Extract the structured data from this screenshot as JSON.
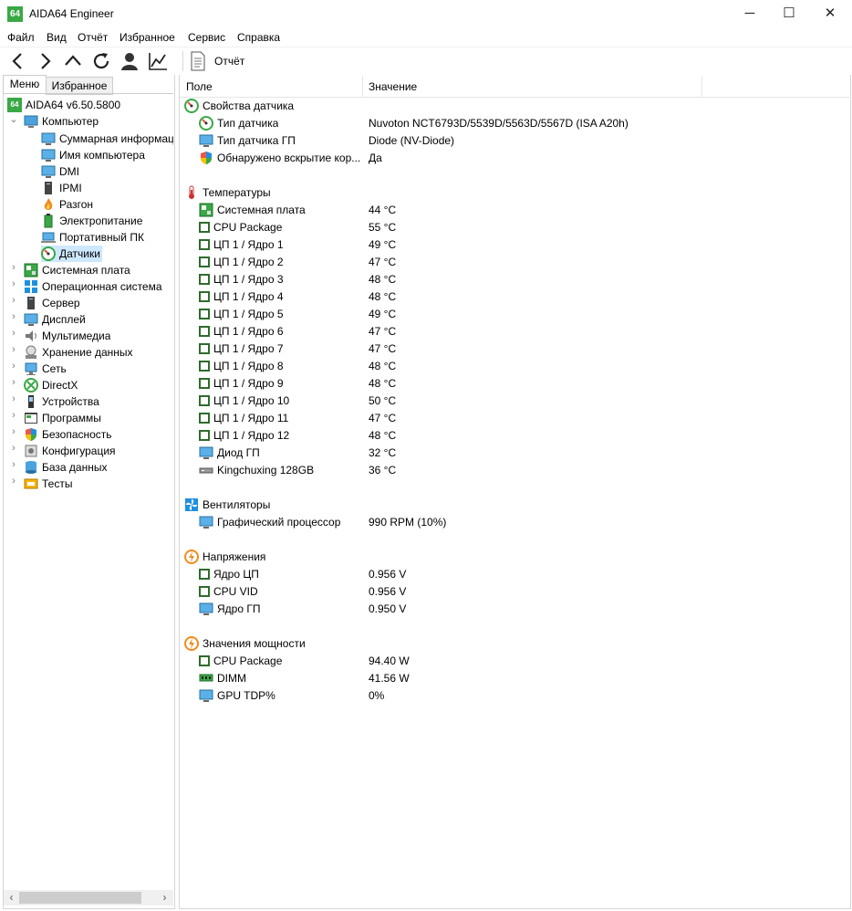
{
  "app": {
    "title": "AIDA64 Engineer",
    "logo": "64"
  },
  "window_controls": {
    "minimize": "─",
    "maximize": "☐",
    "close": "✕"
  },
  "menu": [
    "Файл",
    "Вид",
    "Отчёт",
    "Избранное",
    "Сервис",
    "Справка"
  ],
  "toolbar": {
    "report": "Отчёт"
  },
  "tabs": {
    "menu": "Меню",
    "favorites": "Избранное"
  },
  "tree": {
    "root": "AIDA64 v6.50.5800",
    "computer": "Компьютер",
    "computer_children": [
      "Суммарная информация",
      "Имя компьютера",
      "DMI",
      "IPMI",
      "Разгон",
      "Электропитание",
      "Портативный ПК",
      "Датчики"
    ],
    "top_items": [
      "Системная плата",
      "Операционная система",
      "Сервер",
      "Дисплей",
      "Мультимедиа",
      "Хранение данных",
      "Сеть",
      "DirectX",
      "Устройства",
      "Программы",
      "Безопасность",
      "Конфигурация",
      "База данных",
      "Тесты"
    ]
  },
  "columns": {
    "field": "Поле",
    "value": "Значение"
  },
  "sections": [
    {
      "title": "Свойства датчика",
      "rows": [
        {
          "field": "Тип датчика",
          "value": "Nuvoton NCT6793D/5539D/5563D/5567D  (ISA A20h)",
          "icon": "sensor"
        },
        {
          "field": "Тип датчика ГП",
          "value": "Diode  (NV-Diode)",
          "icon": "monitor"
        },
        {
          "field": "Обнаружено вскрытие кор...",
          "value": "Да",
          "icon": "shield"
        }
      ]
    },
    {
      "title": "Температуры",
      "rows": [
        {
          "field": "Системная плата",
          "value": "44 °C",
          "icon": "board"
        },
        {
          "field": "CPU Package",
          "value": "55 °C",
          "icon": "chip"
        },
        {
          "field": "ЦП 1 / Ядро 1",
          "value": "49 °C",
          "icon": "chip"
        },
        {
          "field": "ЦП 1 / Ядро 2",
          "value": "47 °C",
          "icon": "chip"
        },
        {
          "field": "ЦП 1 / Ядро 3",
          "value": "48 °C",
          "icon": "chip"
        },
        {
          "field": "ЦП 1 / Ядро 4",
          "value": "48 °C",
          "icon": "chip"
        },
        {
          "field": "ЦП 1 / Ядро 5",
          "value": "49 °C",
          "icon": "chip"
        },
        {
          "field": "ЦП 1 / Ядро 6",
          "value": "47 °C",
          "icon": "chip"
        },
        {
          "field": "ЦП 1 / Ядро 7",
          "value": "47 °C",
          "icon": "chip"
        },
        {
          "field": "ЦП 1 / Ядро 8",
          "value": "48 °C",
          "icon": "chip"
        },
        {
          "field": "ЦП 1 / Ядро 9",
          "value": "48 °C",
          "icon": "chip"
        },
        {
          "field": "ЦП 1 / Ядро 10",
          "value": "50 °C",
          "icon": "chip"
        },
        {
          "field": "ЦП 1 / Ядро 11",
          "value": "47 °C",
          "icon": "chip"
        },
        {
          "field": "ЦП 1 / Ядро 12",
          "value": "48 °C",
          "icon": "chip"
        },
        {
          "field": "Диод ГП",
          "value": "32 °C",
          "icon": "monitor"
        },
        {
          "field": "Kingchuxing 128GB",
          "value": "36 °C",
          "icon": "disk"
        }
      ]
    },
    {
      "title": "Вентиляторы",
      "rows": [
        {
          "field": "Графический процессор",
          "value": "990 RPM  (10%)",
          "icon": "monitor"
        }
      ]
    },
    {
      "title": "Напряжения",
      "rows": [
        {
          "field": "Ядро ЦП",
          "value": "0.956 V",
          "icon": "chip"
        },
        {
          "field": "CPU VID",
          "value": "0.956 V",
          "icon": "chip"
        },
        {
          "field": "Ядро ГП",
          "value": "0.950 V",
          "icon": "monitor"
        }
      ]
    },
    {
      "title": "Значения мощности",
      "rows": [
        {
          "field": "CPU Package",
          "value": "94.40 W",
          "icon": "chip"
        },
        {
          "field": "DIMM",
          "value": "41.56 W",
          "icon": "dimm"
        },
        {
          "field": "GPU TDP%",
          "value": "0%",
          "icon": "monitor"
        }
      ]
    }
  ],
  "section_icons": [
    "sensor-icon",
    "thermometer-icon",
    "fan-icon",
    "voltage-icon",
    "power-icon"
  ]
}
